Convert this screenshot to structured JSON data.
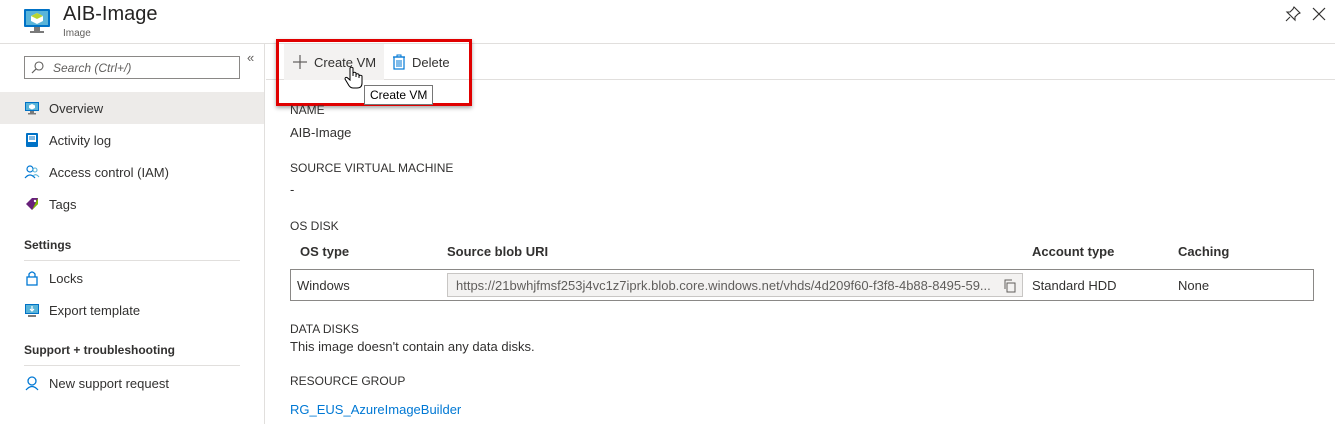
{
  "header": {
    "title": "AIB-Image",
    "subtitle": "Image"
  },
  "sidebar": {
    "search_placeholder": "Search (Ctrl+/)",
    "collapse_glyph": "«",
    "items": [
      {
        "label": "Overview",
        "icon": "overview-icon"
      },
      {
        "label": "Activity log",
        "icon": "activity-log-icon"
      },
      {
        "label": "Access control (IAM)",
        "icon": "access-control-icon"
      },
      {
        "label": "Tags",
        "icon": "tag-icon"
      }
    ],
    "settings_header": "Settings",
    "settings_items": [
      {
        "label": "Locks",
        "icon": "lock-icon"
      },
      {
        "label": "Export template",
        "icon": "export-template-icon"
      }
    ],
    "support_header": "Support + troubleshooting",
    "support_items": [
      {
        "label": "New support request",
        "icon": "support-icon"
      }
    ]
  },
  "toolbar": {
    "create_vm_label": "Create VM",
    "delete_label": "Delete",
    "tooltip": "Create VM"
  },
  "details": {
    "name_label": "NAME",
    "name_value": "AIB-Image",
    "source_vm_label": "SOURCE VIRTUAL MACHINE",
    "source_vm_value": "-",
    "os_disk_label": "OS DISK",
    "os_disk_columns": [
      "OS type",
      "Source blob URI",
      "Account type",
      "Caching"
    ],
    "os_disk_row": {
      "os_type": "Windows",
      "source_blob_uri": "https://21bwhjfmsf253j4vc1z7iprk.blob.core.windows.net/vhds/4d209f60-f3f8-4b88-8495-59...",
      "account_type": "Standard HDD",
      "caching": "None"
    },
    "data_disks_label": "DATA DISKS",
    "data_disks_value": "This image doesn't contain any data disks.",
    "resource_group_label": "RESOURCE GROUP",
    "resource_group_value": "RG_EUS_AzureImageBuilder"
  },
  "colors": {
    "accent": "#0078d4",
    "highlight_border": "#e00000",
    "active_nav": "#edebe9"
  }
}
